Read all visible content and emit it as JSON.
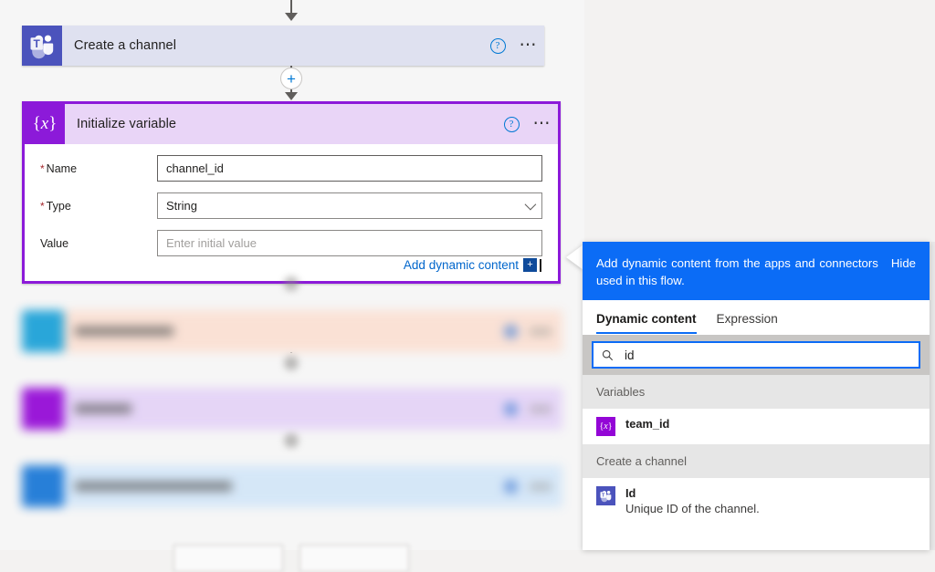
{
  "canvas": {
    "create_channel_card": {
      "title": "Create a channel",
      "icon": "microsoft-teams-icon",
      "help_icon": "help-question-icon",
      "menu_icon": "more-options-ellipsis-icon",
      "header_color": "#dfe1f0"
    },
    "initialize_variable_card": {
      "title": "Initialize variable",
      "icon": "variable-braces-icon",
      "help_icon": "help-question-icon",
      "menu_icon": "more-options-ellipsis-icon",
      "selected_border_color": "#8c1ad9",
      "header_color": "#e9d5f7",
      "fields": [
        {
          "label": "Name",
          "required": true,
          "value": "channel_id",
          "placeholder": "Enter variable name",
          "control": "text"
        },
        {
          "label": "Type",
          "required": true,
          "value": "String",
          "control": "dropdown"
        },
        {
          "label": "Value",
          "required": false,
          "value": "",
          "placeholder": "Enter initial value",
          "control": "text"
        }
      ],
      "add_dynamic_content_label": "Add dynamic content",
      "add_dynamic_content_plus": "+"
    },
    "insert_node_label": "+",
    "dimmed_cards": [
      {
        "icon_color": "#18a0d7",
        "header_color": "#fbe0d3"
      },
      {
        "icon_color": "#9306d6",
        "header_color": "#e4d3f7"
      },
      {
        "icon_color": "#1675d6",
        "header_color": "#d3e6f8"
      }
    ]
  },
  "dynamic_content_panel": {
    "banner_text": "Add dynamic content from the apps and connectors used in this flow.",
    "hide_label": "Hide",
    "banner_color": "#0b6cf6",
    "tabs": [
      {
        "label": "Dynamic content",
        "active": true
      },
      {
        "label": "Expression",
        "active": false
      }
    ],
    "search": {
      "value": "id",
      "placeholder": "Search dynamic content",
      "icon": "search-magnifier-icon"
    },
    "groups": [
      {
        "label": "Variables",
        "items": [
          {
            "name": "team_id",
            "description": "",
            "icon": "variable-braces-icon"
          }
        ]
      },
      {
        "label": "Create a channel",
        "items": [
          {
            "name": "Id",
            "description": "Unique ID of the channel.",
            "icon": "microsoft-teams-icon"
          }
        ]
      }
    ]
  }
}
